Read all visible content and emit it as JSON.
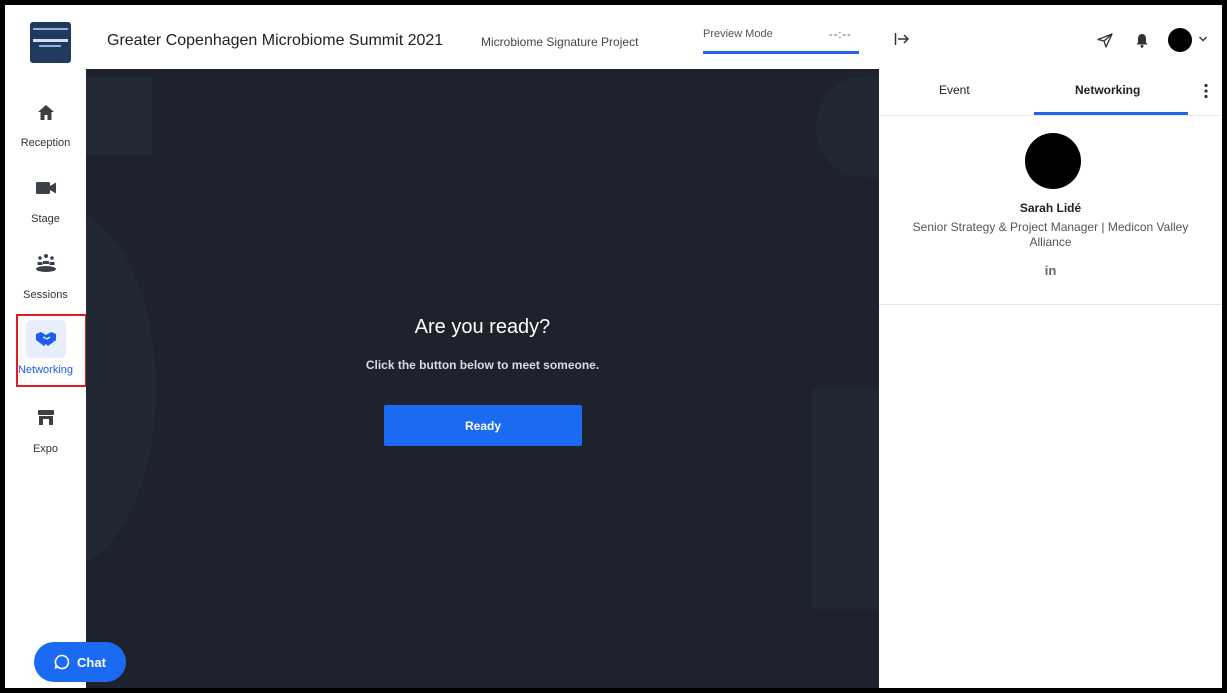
{
  "header": {
    "event_title": "Greater Copenhagen Microbiome Summit 2021",
    "project_title": "Microbiome Signature Project",
    "preview_label": "Preview Mode",
    "preview_time": "--:--"
  },
  "sidebar": {
    "items": [
      {
        "label": "Reception",
        "icon": "home-icon"
      },
      {
        "label": "Stage",
        "icon": "video-camera-icon"
      },
      {
        "label": "Sessions",
        "icon": "people-icon"
      },
      {
        "label": "Networking",
        "icon": "handshake-icon",
        "active": true
      },
      {
        "label": "Expo",
        "icon": "booth-icon"
      }
    ]
  },
  "stage": {
    "title": "Are you ready?",
    "subtitle": "Click the button below to meet someone.",
    "button_label": "Ready"
  },
  "chat": {
    "label": "Chat"
  },
  "right_panel": {
    "tabs": [
      {
        "label": "Event"
      },
      {
        "label": "Networking",
        "active": true
      }
    ],
    "profile": {
      "name": "Sarah Lidé",
      "role": "Senior Strategy & Project Manager | Medicon Valley Alliance",
      "linkedin_label": "in"
    }
  },
  "colors": {
    "accent": "#1a6af2",
    "stage_bg": "#1e222c",
    "highlight_outline": "#e01b24"
  }
}
